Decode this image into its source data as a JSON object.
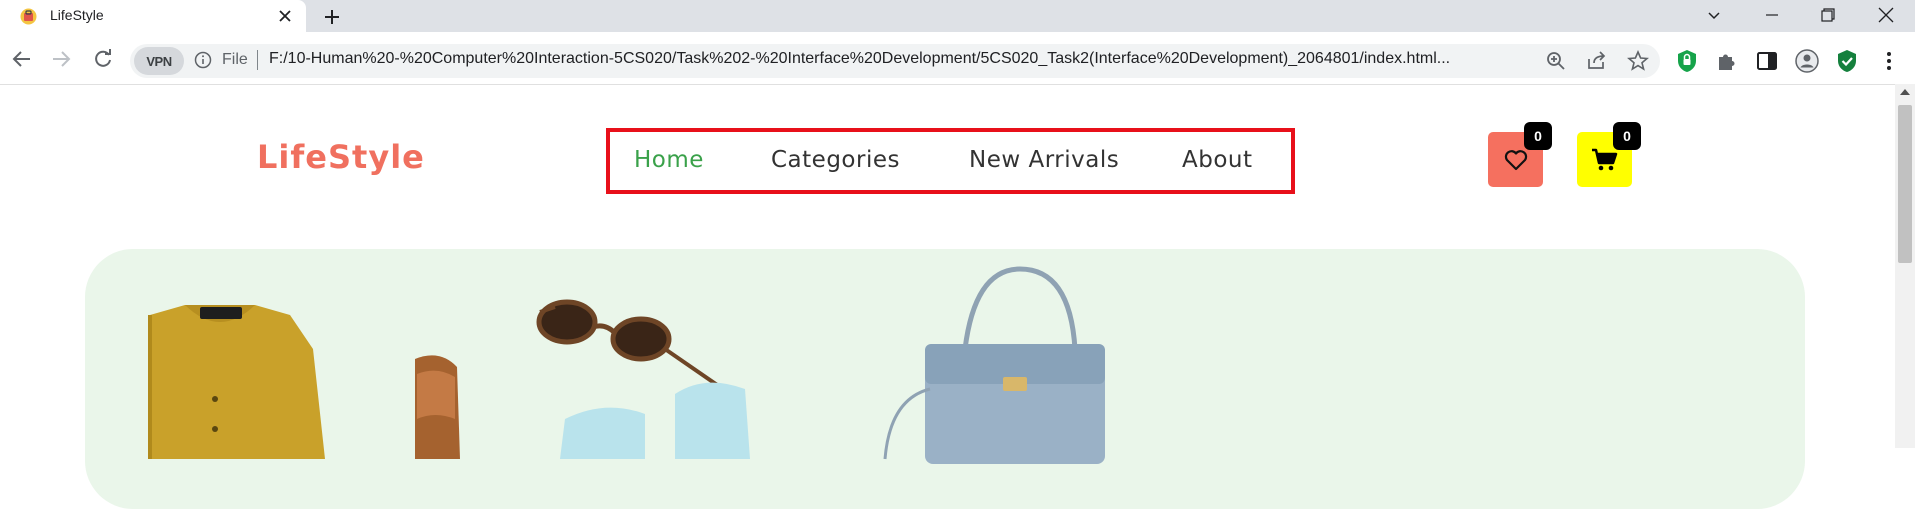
{
  "browser": {
    "tab_title": "LifeStyle",
    "address": {
      "vpn_label": "VPN",
      "scheme_label": "File",
      "url": "F:/10-Human%20-%20Computer%20Interaction-5CS020/Task%202-%20Interface%20Development/5CS020_Task2(Interface%20Development)_2064801/index.html..."
    }
  },
  "site": {
    "brand": "LifeStyle",
    "nav": {
      "items": [
        {
          "label": "Home",
          "active": true
        },
        {
          "label": "Categories",
          "active": false
        },
        {
          "label": "New Arrivals",
          "active": false
        },
        {
          "label": "About",
          "active": false
        }
      ]
    },
    "wishlist": {
      "count": "0"
    },
    "cart": {
      "count": "0"
    }
  },
  "colors": {
    "brand": "#f0705f",
    "nav_active": "#3aa14a",
    "nav_highlight_border": "#e8101a",
    "wishlist_button": "#f5705f",
    "cart_button": "#ffff00",
    "hero_background": "#eaf6ea"
  },
  "icons": [
    "favicon-icon",
    "close-icon",
    "plus-icon",
    "chevron-down-icon",
    "minimize-icon",
    "restore-icon",
    "window-close-icon",
    "back-arrow-icon",
    "forward-arrow-icon",
    "reload-icon",
    "info-icon",
    "zoom-icon",
    "share-icon",
    "star-icon",
    "shield-extension-icon",
    "puzzle-icon",
    "sidepanel-icon",
    "profile-icon",
    "check-shield-icon",
    "kebab-menu-icon",
    "heart-icon",
    "cart-icon"
  ]
}
